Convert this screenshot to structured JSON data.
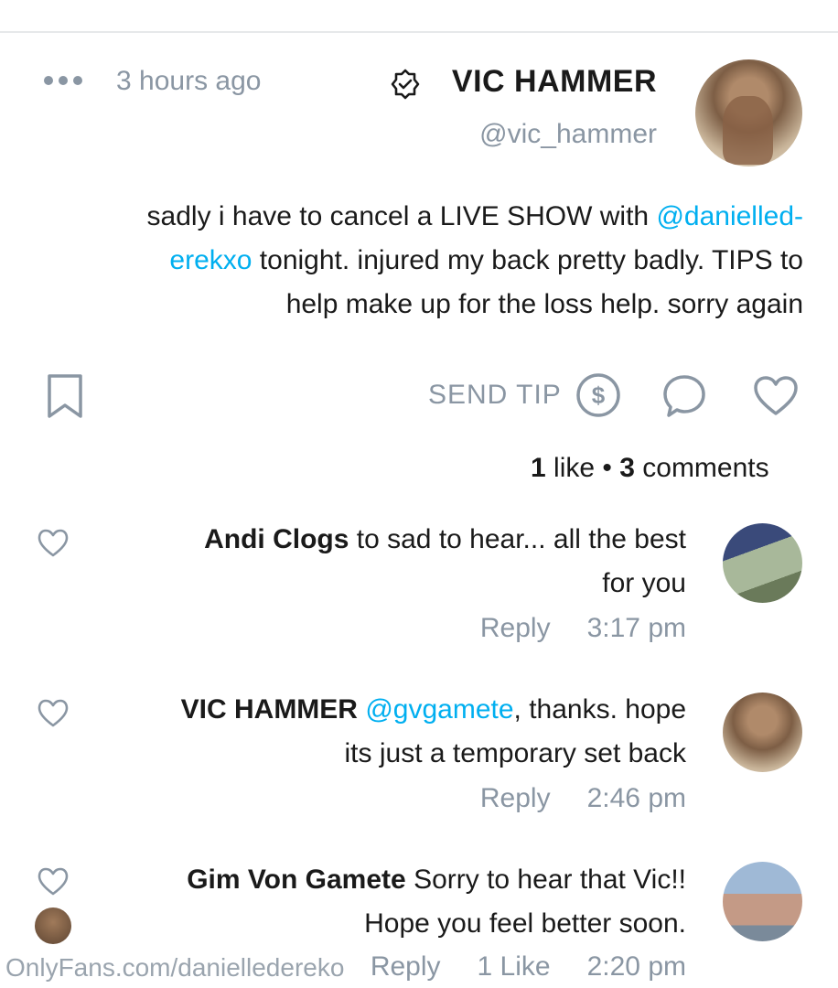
{
  "post": {
    "author_name": "VIC HAMMER",
    "handle": "@vic_hammer",
    "time": "3 hours ago",
    "text_line1_pre": "sadly i have to cancel a LIVE SHOW with ",
    "text_line1_mention": "@danielled-",
    "text_line2_mention": "erekxo",
    "text_line2_post": " tonight. injured my back pretty badly. TIPS to",
    "text_line3": "help make up for the loss help. sorry again",
    "send_tip_label": "SEND TIP",
    "likes_count": "1",
    "likes_word": " like",
    "dot": " • ",
    "comments_count": "3",
    "comments_word": " comments"
  },
  "comments": [
    {
      "author": "Andi Clogs",
      "text_line1": " to sad to hear... all the best",
      "text_line2": "for you",
      "time": "3:17 pm",
      "reply": "Reply"
    },
    {
      "author": "VIC HAMMER",
      "mention": " @gvgamete",
      "text_line1": ", thanks. hope",
      "text_line2": "its just a temporary set back",
      "time": "2:46 pm",
      "reply": "Reply"
    },
    {
      "author": "Gim Von Gamete",
      "text_line1": " Sorry to hear that Vic!!",
      "text_line2": "Hope you feel better soon.",
      "time": "2:20 pm",
      "likes": "1 Like",
      "reply": "Reply"
    }
  ],
  "watermark": "OnlyFans.com/danielledereko",
  "colors": {
    "accent": "#00aff0",
    "muted": "#8a96a3",
    "text": "#1a1a1a"
  }
}
